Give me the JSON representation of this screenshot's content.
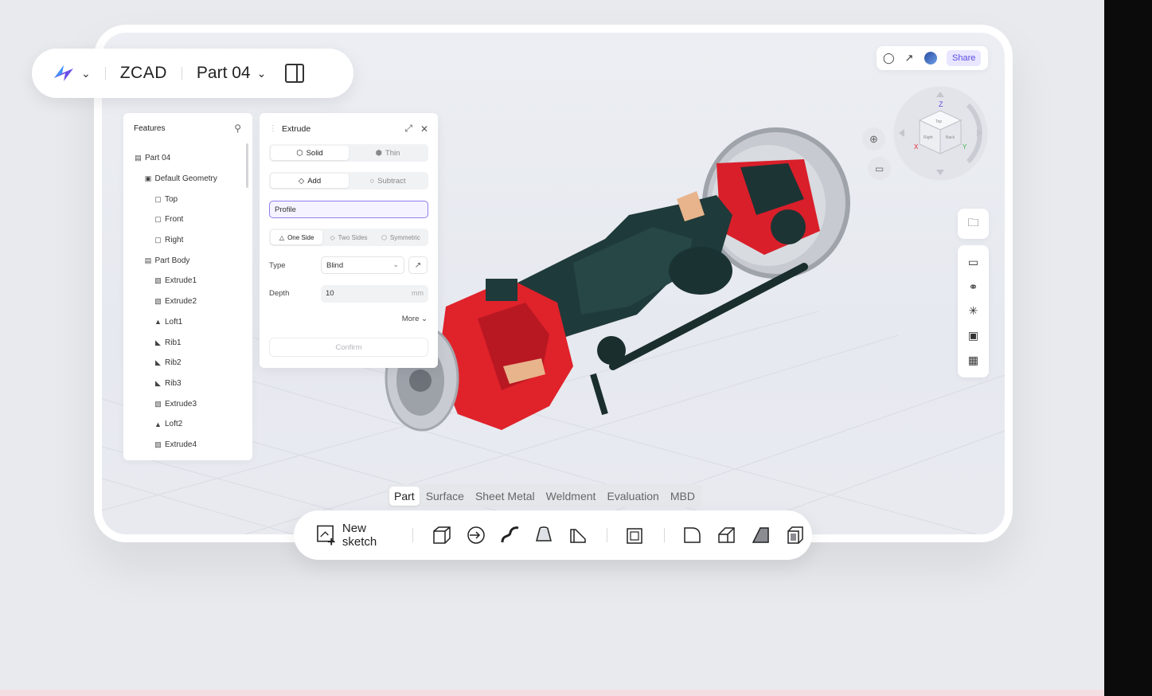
{
  "header": {
    "app_name": "ZCAD",
    "part_name": "Part 04",
    "logo_icon": "zcad-logo",
    "brand_color": "#6b4de6"
  },
  "top_right": {
    "icons": [
      "bell-icon",
      "external-link-icon",
      "avatar"
    ],
    "share_label": "Share"
  },
  "features": {
    "title": "Features",
    "items": [
      {
        "label": "Part 04",
        "icon": "part-icon",
        "level": 0
      },
      {
        "label": "Default Geometry",
        "icon": "geometry-icon",
        "level": 1
      },
      {
        "label": "Top",
        "icon": "plane-icon",
        "level": 2
      },
      {
        "label": "Front",
        "icon": "plane-icon",
        "level": 2
      },
      {
        "label": "Right",
        "icon": "plane-icon",
        "level": 2
      },
      {
        "label": "Part Body",
        "icon": "body-icon",
        "level": 1
      },
      {
        "label": "Extrude1",
        "icon": "extrude-icon",
        "level": 2
      },
      {
        "label": "Extrude2",
        "icon": "extrude-icon",
        "level": 2
      },
      {
        "label": "Loft1",
        "icon": "loft-icon",
        "level": 2
      },
      {
        "label": "Rib1",
        "icon": "rib-icon",
        "level": 2
      },
      {
        "label": "Rib2",
        "icon": "rib-icon",
        "level": 2
      },
      {
        "label": "Rib3",
        "icon": "rib-icon",
        "level": 2
      },
      {
        "label": "Extrude3",
        "icon": "extrude-icon",
        "level": 2
      },
      {
        "label": "Loft2",
        "icon": "loft-icon",
        "level": 2
      },
      {
        "label": "Extrude4",
        "icon": "extrude-icon",
        "level": 2
      }
    ]
  },
  "extrude": {
    "title": "Extrude",
    "body_type": {
      "options": [
        "Solid",
        "Thin"
      ],
      "selected": "Solid"
    },
    "operation": {
      "options": [
        "Add",
        "Subtract"
      ],
      "selected": "Add"
    },
    "profile_label": "Profile",
    "direction": {
      "options": [
        "One Side",
        "Two Sides",
        "Symmetric"
      ],
      "selected": "One Side"
    },
    "type_label": "Type",
    "type_value": "Blind",
    "depth_label": "Depth",
    "depth_value": "10",
    "depth_unit": "mm",
    "more_label": "More",
    "confirm_label": "Confirm",
    "accent_color": "#8f7ff0"
  },
  "viewcube": {
    "axis_labels": [
      "Z",
      "X",
      "Y"
    ],
    "faces": [
      "Top",
      "Right",
      "Back"
    ]
  },
  "right_toolbar": {
    "single": "folder-icon",
    "group": [
      "monitor-icon",
      "color-circles-icon",
      "sparkle-icon",
      "clipboard-icon",
      "table-icon"
    ]
  },
  "modes": {
    "tabs": [
      "Part",
      "Surface",
      "Sheet Metal",
      "Weldment",
      "Evaluation",
      "MBD"
    ],
    "active": "Part"
  },
  "bottom_toolbar": {
    "new_sketch_label": "New sketch",
    "tools": [
      "extrude-tool-icon",
      "revolve-tool-icon",
      "sweep-tool-icon",
      "loft-tool-icon",
      "rib-tool-icon",
      "shell-tool-icon",
      "fillet-tool-icon",
      "chamfer-tool-icon",
      "draft-tool-icon",
      "thicken-tool-icon"
    ]
  },
  "model": {
    "body_color": "#1f3a3a",
    "caliper_color": "#e0222b",
    "metal_color": "#b9bcc2"
  }
}
